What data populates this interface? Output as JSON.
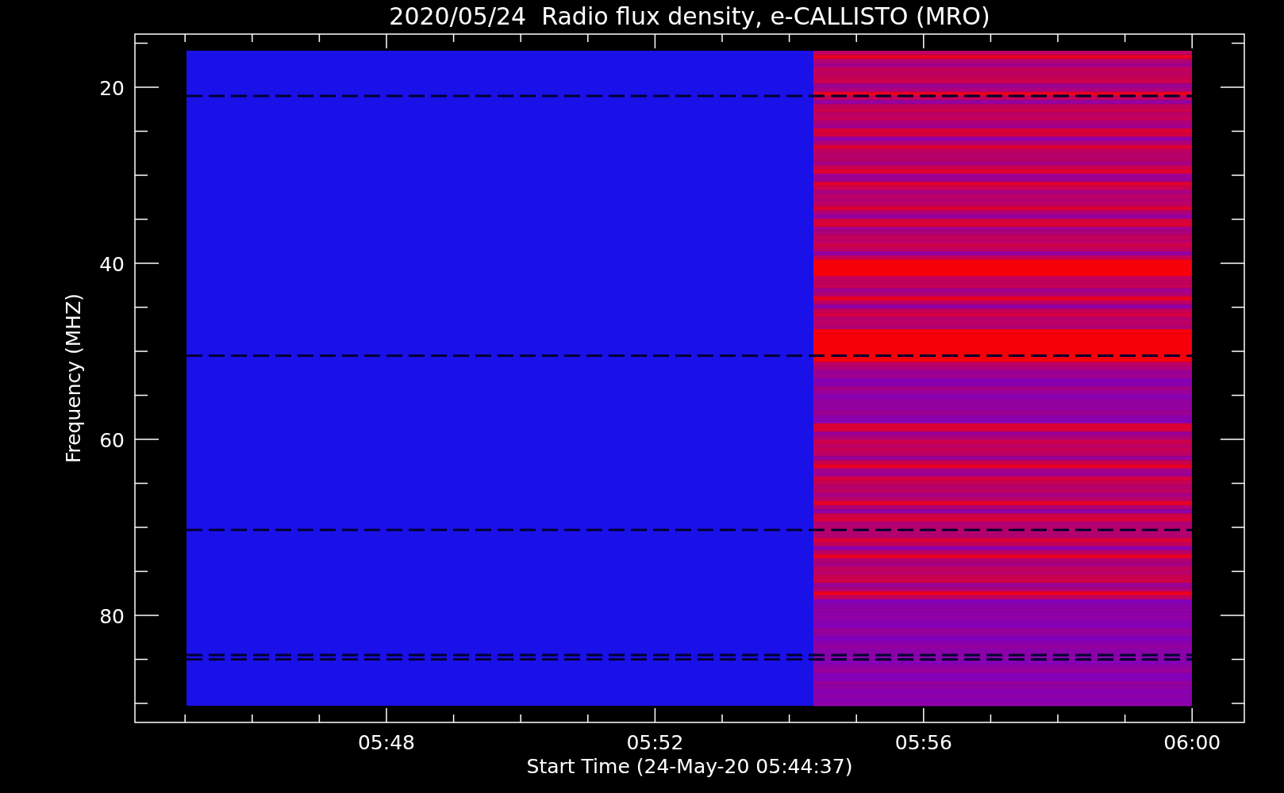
{
  "title": "2020/05/24  Radio flux density, e-CALLISTO (MRO)",
  "y_axis": {
    "label": "Frequency (MHZ)",
    "tick_labels": [
      "20",
      "40",
      "60",
      "80"
    ]
  },
  "x_axis": {
    "label": "Start Time (24-May-20 05:44:37)",
    "tick_labels": [
      "05:48",
      "05:52",
      "05:56",
      "06:00"
    ]
  }
}
